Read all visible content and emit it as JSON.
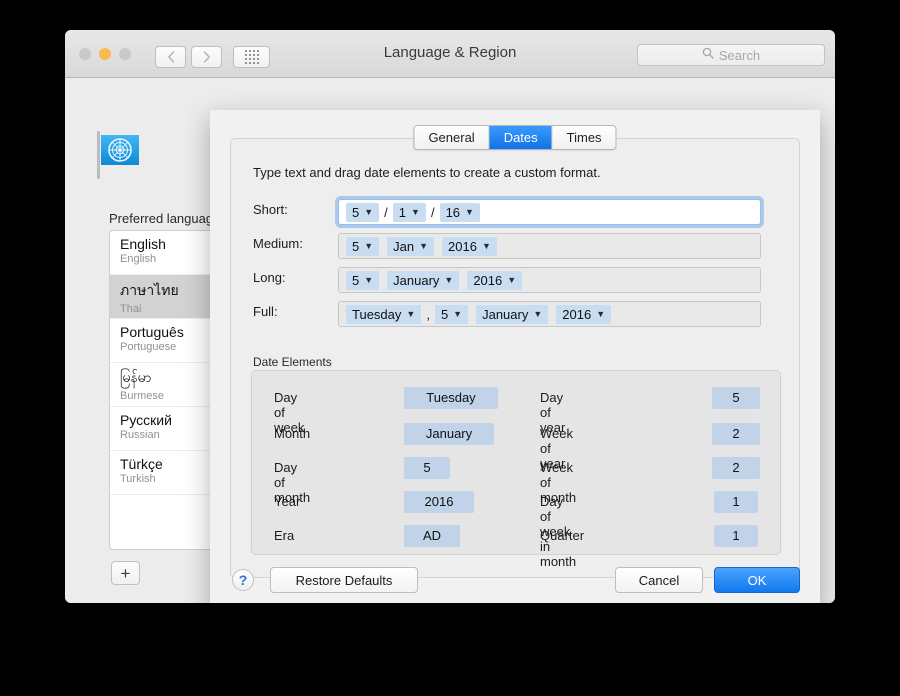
{
  "window": {
    "title": "Language & Region",
    "traffic_lights": [
      "close",
      "minimize",
      "zoom"
    ],
    "nav": {
      "back_icon": "chevron-left-icon",
      "forward_icon": "chevron-right-icon",
      "showall_icon": "grid-icon"
    },
    "search": {
      "placeholder": "Search",
      "icon": "search-icon"
    },
    "flag_icon": "un-flag-icon",
    "preferred_label": "Preferred languages:",
    "languages": [
      {
        "name": "English",
        "sub": "English",
        "selected": false
      },
      {
        "name": "ภาษาไทย",
        "sub": "Thai",
        "selected": true
      },
      {
        "name": "Português",
        "sub": "Portuguese",
        "selected": false
      },
      {
        "name": "မြန်မာ",
        "sub": "Burmese",
        "selected": false
      },
      {
        "name": "Русский",
        "sub": "Russian",
        "selected": false
      },
      {
        "name": "Türkçe",
        "sub": "Turkish",
        "selected": false
      }
    ],
    "add_button": "+",
    "help_label": "?"
  },
  "sheet": {
    "tabs": [
      {
        "label": "General",
        "active": false
      },
      {
        "label": "Dates",
        "active": true
      },
      {
        "label": "Times",
        "active": false
      }
    ],
    "hint": "Type text and drag date elements to create a custom format.",
    "formats": [
      {
        "label": "Short:",
        "focused": true,
        "parts": [
          {
            "type": "token",
            "text": "5",
            "chevron": "chevron-down-icon"
          },
          {
            "type": "sep",
            "text": "/"
          },
          {
            "type": "token",
            "text": "1",
            "chevron": "chevron-down-icon"
          },
          {
            "type": "sep",
            "text": "/"
          },
          {
            "type": "token",
            "text": "16",
            "chevron": "chevron-down-icon"
          }
        ]
      },
      {
        "label": "Medium:",
        "focused": false,
        "parts": [
          {
            "type": "token",
            "text": "5",
            "chevron": "chevron-down-icon"
          },
          {
            "type": "gap"
          },
          {
            "type": "token",
            "text": "Jan",
            "chevron": "chevron-down-icon"
          },
          {
            "type": "gap"
          },
          {
            "type": "token",
            "text": "2016",
            "chevron": "chevron-down-icon"
          }
        ]
      },
      {
        "label": "Long:",
        "focused": false,
        "parts": [
          {
            "type": "token",
            "text": "5",
            "chevron": "chevron-down-icon"
          },
          {
            "type": "gap"
          },
          {
            "type": "token",
            "text": "January",
            "chevron": "chevron-down-icon"
          },
          {
            "type": "gap"
          },
          {
            "type": "token",
            "text": "2016",
            "chevron": "chevron-down-icon"
          }
        ]
      },
      {
        "label": "Full:",
        "focused": false,
        "parts": [
          {
            "type": "token",
            "text": "Tuesday",
            "chevron": "chevron-down-icon"
          },
          {
            "type": "sep",
            "text": ","
          },
          {
            "type": "token",
            "text": "5",
            "chevron": "chevron-down-icon"
          },
          {
            "type": "gap"
          },
          {
            "type": "token",
            "text": "January",
            "chevron": "chevron-down-icon"
          },
          {
            "type": "gap"
          },
          {
            "type": "token",
            "text": "2016",
            "chevron": "chevron-down-icon"
          }
        ]
      }
    ],
    "date_elements": {
      "group_label": "Date Elements",
      "left": [
        {
          "label": "Day of week",
          "value": "Tuesday"
        },
        {
          "label": "Month",
          "value": "January"
        },
        {
          "label": "Day of month",
          "value": "5"
        },
        {
          "label": "Year",
          "value": "2016"
        },
        {
          "label": "Era",
          "value": "AD"
        }
      ],
      "right": [
        {
          "label": "Day of year",
          "value": "5"
        },
        {
          "label": "Week of year",
          "value": "2"
        },
        {
          "label": "Week of month",
          "value": "2"
        },
        {
          "label": "Day of week in month",
          "value": "1"
        },
        {
          "label": "Quarter",
          "value": "1"
        }
      ]
    },
    "footer": {
      "help_label": "?",
      "restore_label": "Restore Defaults",
      "cancel_label": "Cancel",
      "ok_label": "OK"
    }
  },
  "colors": {
    "accent": "#1272e8",
    "token": "#c9ddf2",
    "token_element": "#c0d3e8",
    "selected_row": "#d2d2d2"
  }
}
